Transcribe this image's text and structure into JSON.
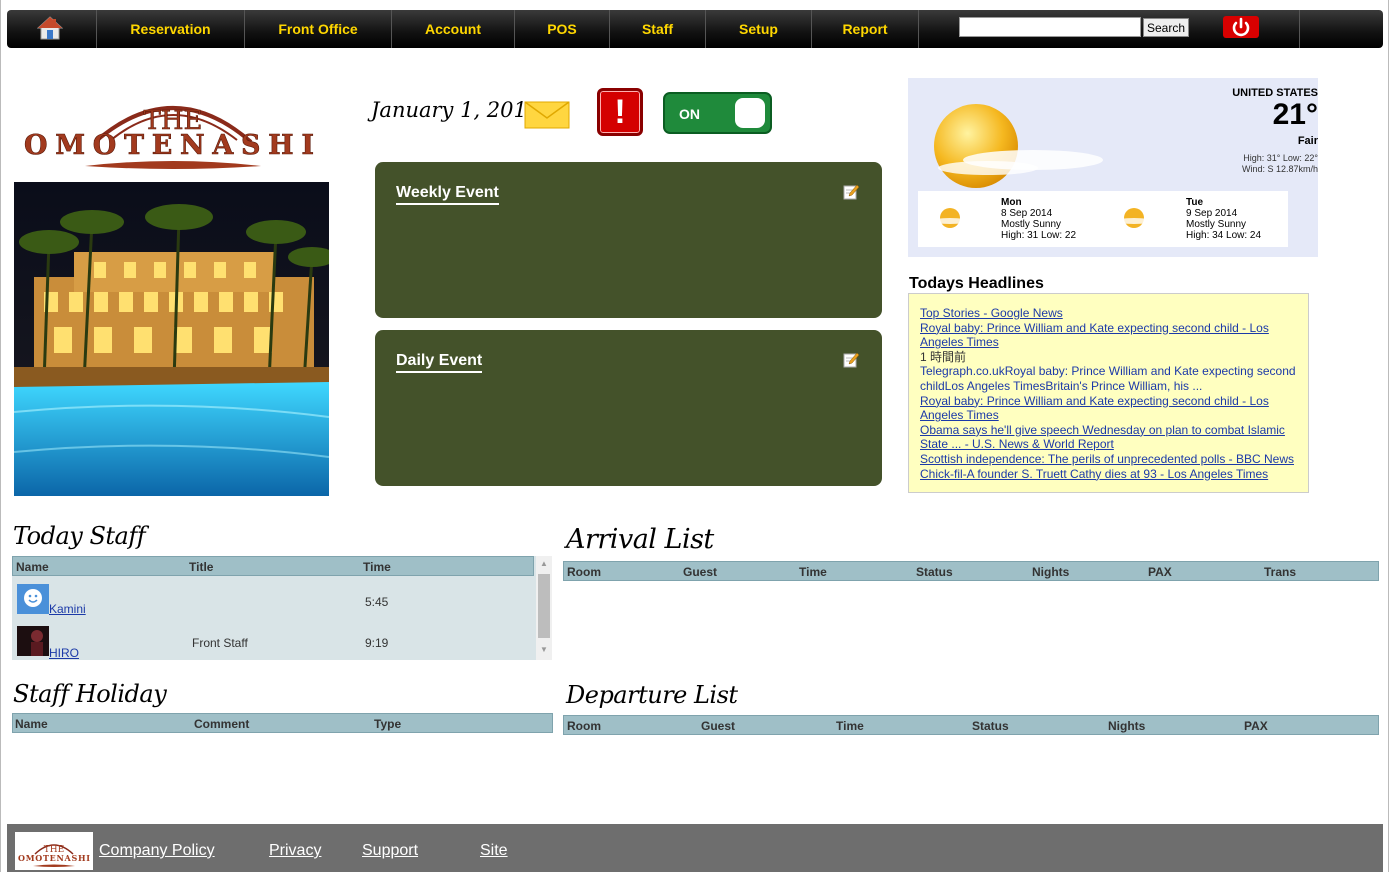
{
  "nav": {
    "items": [
      "Reservation",
      "Front Office",
      "Account",
      "POS",
      "Staff",
      "Setup",
      "Report"
    ],
    "search_button": "Search",
    "search_value": ""
  },
  "logo": {
    "line1": "THE",
    "line2": "OMOTENASHI"
  },
  "date": "January 1, 2015",
  "toggle": {
    "label": "ON"
  },
  "events": {
    "weekly": "Weekly Event",
    "daily": "Daily Event"
  },
  "weather": {
    "country": "UNITED STATES",
    "temp": "21°",
    "condition": "Fair",
    "highlow": "High: 31° Low: 22°",
    "wind": "Wind: S 12.87km/h",
    "forecast": [
      {
        "day": "Mon",
        "date": "8 Sep 2014",
        "desc": "Mostly Sunny",
        "hl": "High: 31 Low: 22"
      },
      {
        "day": "Tue",
        "date": "9 Sep 2014",
        "desc": "Mostly Sunny",
        "hl": "High: 34 Low: 24"
      }
    ]
  },
  "headlines": {
    "title": "Todays Headlines",
    "items": [
      {
        "text": "Top Stories - Google News",
        "type": "link"
      },
      {
        "text": "Royal baby: Prince William and Kate expecting second child - Los Angeles Times",
        "type": "link"
      },
      {
        "text": "1 時間前",
        "type": "plain"
      },
      {
        "text": "Telegraph.co.ukRoyal baby: Prince William and Kate expecting second childLos Angeles TimesBritain's Prince William, his ...",
        "type": "blue"
      },
      {
        "text": "Royal baby: Prince William and Kate expecting second child - Los Angeles Times",
        "type": "link"
      },
      {
        "text": "Obama says he'll give speech Wednesday on plan to combat Islamic State ... - U.S. News & World Report",
        "type": "link"
      },
      {
        "text": "Scottish independence: The perils of unprecedented polls - BBC News",
        "type": "link"
      },
      {
        "text": "Chick-fil-A founder S. Truett Cathy dies at 93 - Los Angeles Times",
        "type": "link"
      }
    ]
  },
  "today_staff": {
    "title": "Today Staff",
    "columns": [
      "Name",
      "Title",
      "Time"
    ],
    "rows": [
      {
        "name": "Kamini",
        "title": "",
        "time": "5:45"
      },
      {
        "name": "HIRO",
        "title": "Front Staff",
        "time": "9:19"
      }
    ]
  },
  "arrival": {
    "title": "Arrival List",
    "columns": [
      "Room",
      "Guest",
      "Time",
      "Status",
      "Nights",
      "PAX",
      "Trans"
    ]
  },
  "holiday": {
    "title": "Staff Holiday",
    "columns": [
      "Name",
      "Comment",
      "Type"
    ]
  },
  "departure": {
    "title": "Departure List",
    "columns": [
      "Room",
      "Guest",
      "Time",
      "Status",
      "Nights",
      "PAX"
    ]
  },
  "footer": {
    "links": [
      "Company Policy",
      "Privacy",
      "Support",
      "Site"
    ],
    "logo_line1": "THE",
    "logo_line2": "OMOTENASHI"
  }
}
